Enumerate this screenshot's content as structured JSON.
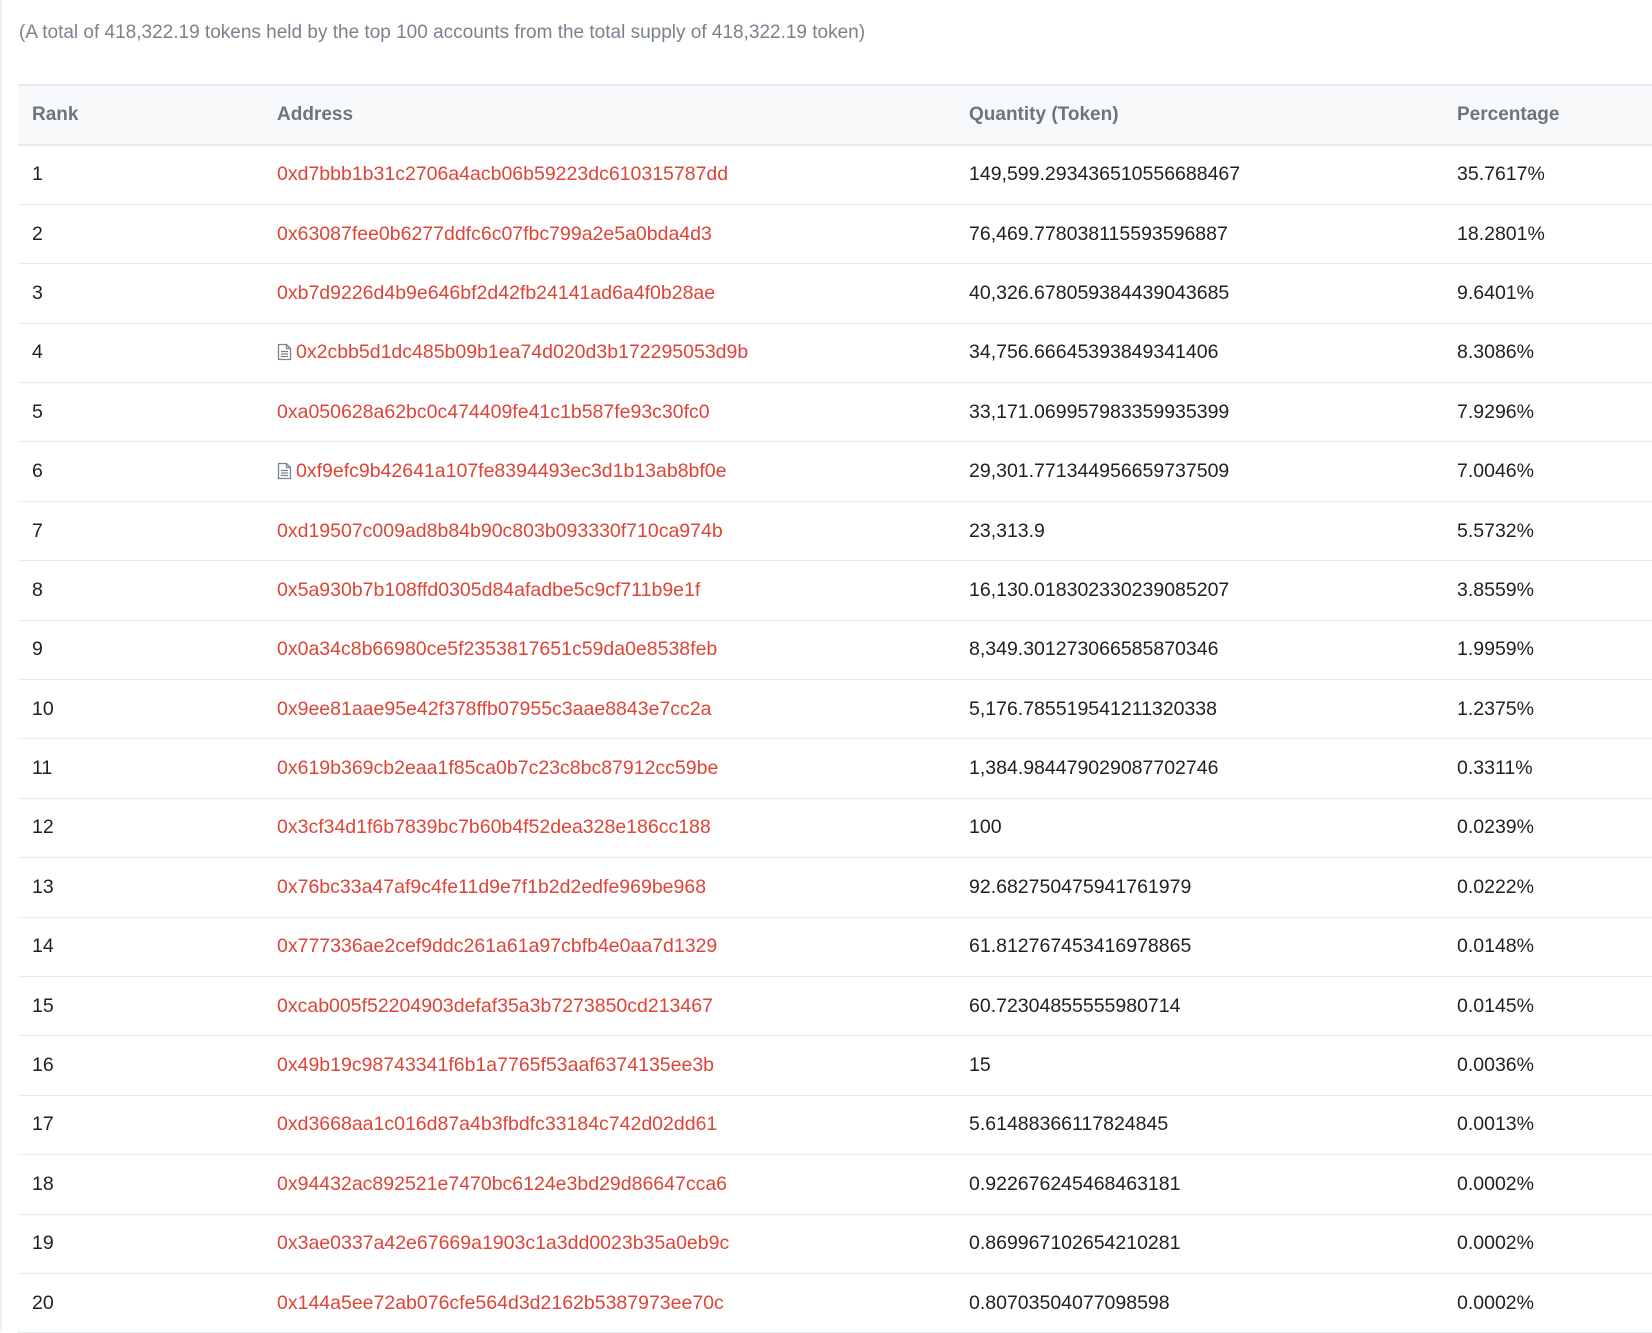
{
  "summary": "(A total of 418,322.19 tokens held by the top 100 accounts from the total supply of 418,322.19 token)",
  "table": {
    "headers": {
      "rank": "Rank",
      "address": "Address",
      "quantity": "Quantity (Token)",
      "percentage": "Percentage"
    },
    "rows": [
      {
        "rank": "1",
        "address": "0xd7bbb1b31c2706a4acb06b59223dc610315787dd",
        "quantity": "149,599.293436510556688467",
        "percentage": "35.7617%",
        "contract": false
      },
      {
        "rank": "2",
        "address": "0x63087fee0b6277ddfc6c07fbc799a2e5a0bda4d3",
        "quantity": "76,469.778038115593596887",
        "percentage": "18.2801%",
        "contract": false
      },
      {
        "rank": "3",
        "address": "0xb7d9226d4b9e646bf2d42fb24141ad6a4f0b28ae",
        "quantity": "40,326.678059384439043685",
        "percentage": "9.6401%",
        "contract": false
      },
      {
        "rank": "4",
        "address": "0x2cbb5d1dc485b09b1ea74d020d3b172295053d9b",
        "quantity": "34,756.66645393849341406",
        "percentage": "8.3086%",
        "contract": true
      },
      {
        "rank": "5",
        "address": "0xa050628a62bc0c474409fe41c1b587fe93c30fc0",
        "quantity": "33,171.069957983359935399",
        "percentage": "7.9296%",
        "contract": false
      },
      {
        "rank": "6",
        "address": "0xf9efc9b42641a107fe8394493ec3d1b13ab8bf0e",
        "quantity": "29,301.771344956659737509",
        "percentage": "7.0046%",
        "contract": true
      },
      {
        "rank": "7",
        "address": "0xd19507c009ad8b84b90c803b093330f710ca974b",
        "quantity": "23,313.9",
        "percentage": "5.5732%",
        "contract": false
      },
      {
        "rank": "8",
        "address": "0x5a930b7b108ffd0305d84afadbe5c9cf711b9e1f",
        "quantity": "16,130.018302330239085207",
        "percentage": "3.8559%",
        "contract": false
      },
      {
        "rank": "9",
        "address": "0x0a34c8b66980ce5f2353817651c59da0e8538feb",
        "quantity": "8,349.301273066585870346",
        "percentage": "1.9959%",
        "contract": false
      },
      {
        "rank": "10",
        "address": "0x9ee81aae95e42f378ffb07955c3aae8843e7cc2a",
        "quantity": "5,176.785519541211320338",
        "percentage": "1.2375%",
        "contract": false
      },
      {
        "rank": "11",
        "address": "0x619b369cb2eaa1f85ca0b7c23c8bc87912cc59be",
        "quantity": "1,384.984479029087702746",
        "percentage": "0.3311%",
        "contract": false
      },
      {
        "rank": "12",
        "address": "0x3cf34d1f6b7839bc7b60b4f52dea328e186cc188",
        "quantity": "100",
        "percentage": "0.0239%",
        "contract": false
      },
      {
        "rank": "13",
        "address": "0x76bc33a47af9c4fe11d9e7f1b2d2edfe969be968",
        "quantity": "92.682750475941761979",
        "percentage": "0.0222%",
        "contract": false
      },
      {
        "rank": "14",
        "address": "0x777336ae2cef9ddc261a61a97cbfb4e0aa7d1329",
        "quantity": "61.812767453416978865",
        "percentage": "0.0148%",
        "contract": false
      },
      {
        "rank": "15",
        "address": "0xcab005f52204903defaf35a3b7273850cd213467",
        "quantity": "60.72304855555980714",
        "percentage": "0.0145%",
        "contract": false
      },
      {
        "rank": "16",
        "address": "0x49b19c98743341f6b1a7765f53aaf6374135ee3b",
        "quantity": "15",
        "percentage": "0.0036%",
        "contract": false
      },
      {
        "rank": "17",
        "address": "0xd3668aa1c016d87a4b3fbdfc33184c742d02dd61",
        "quantity": "5.61488366117824845",
        "percentage": "0.0013%",
        "contract": false
      },
      {
        "rank": "18",
        "address": "0x94432ac892521e7470bc6124e3bd29d86647cca6",
        "quantity": "0.922676245468463181",
        "percentage": "0.0002%",
        "contract": false
      },
      {
        "rank": "19",
        "address": "0x3ae0337a42e67669a1903c1a3dd0023b35a0eb9c",
        "quantity": "0.869967102654210281",
        "percentage": "0.0002%",
        "contract": false
      },
      {
        "rank": "20",
        "address": "0x144a5ee72ab076cfe564d3d2162b5387973ee70c",
        "quantity": "0.80703504077098598",
        "percentage": "0.0002%",
        "contract": false
      }
    ]
  },
  "icons": {
    "contract": "file-text-icon"
  },
  "colors": {
    "address_link": "#de4437",
    "muted_text": "#77838f",
    "header_text": "#6c757d",
    "body_text": "#1e2022",
    "row_border": "#e7eaf3",
    "header_bg": "#f8f9fa"
  }
}
